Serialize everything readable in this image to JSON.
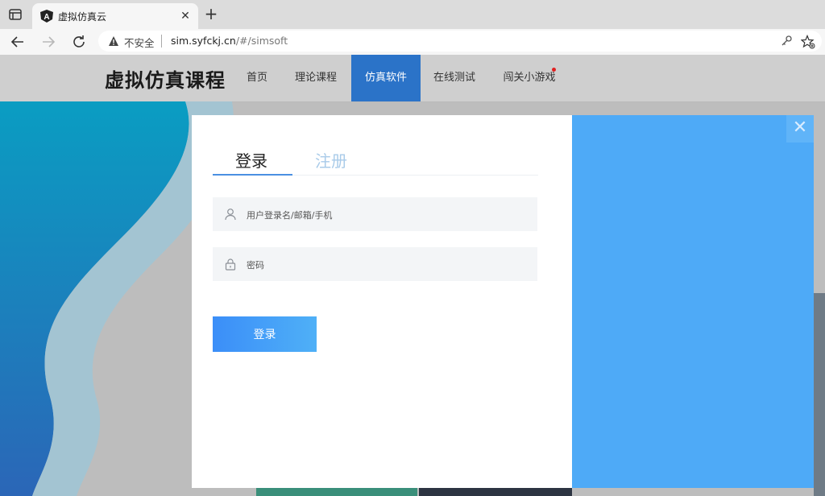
{
  "browser": {
    "tab": {
      "title": "虚拟仿真云",
      "close": "✕"
    },
    "new_tab": "+",
    "security": "不安全",
    "url_host": "sim.syfckj.cn",
    "url_path": "/#/simsoft"
  },
  "site": {
    "logo": "虚拟仿真课程",
    "nav": [
      "首页",
      "理论课程",
      "仿真软件",
      "在线测试",
      "闯关小游戏"
    ],
    "active_nav": "仿真软件",
    "accent": "#2b73c8"
  },
  "modal": {
    "tabs": {
      "login": "登录",
      "register": "注册"
    },
    "username_placeholder": "用户登录名/邮箱/手机",
    "password_placeholder": "密码",
    "submit": "登录",
    "close": "✕",
    "right_panel_color": "#4eaaf7"
  }
}
